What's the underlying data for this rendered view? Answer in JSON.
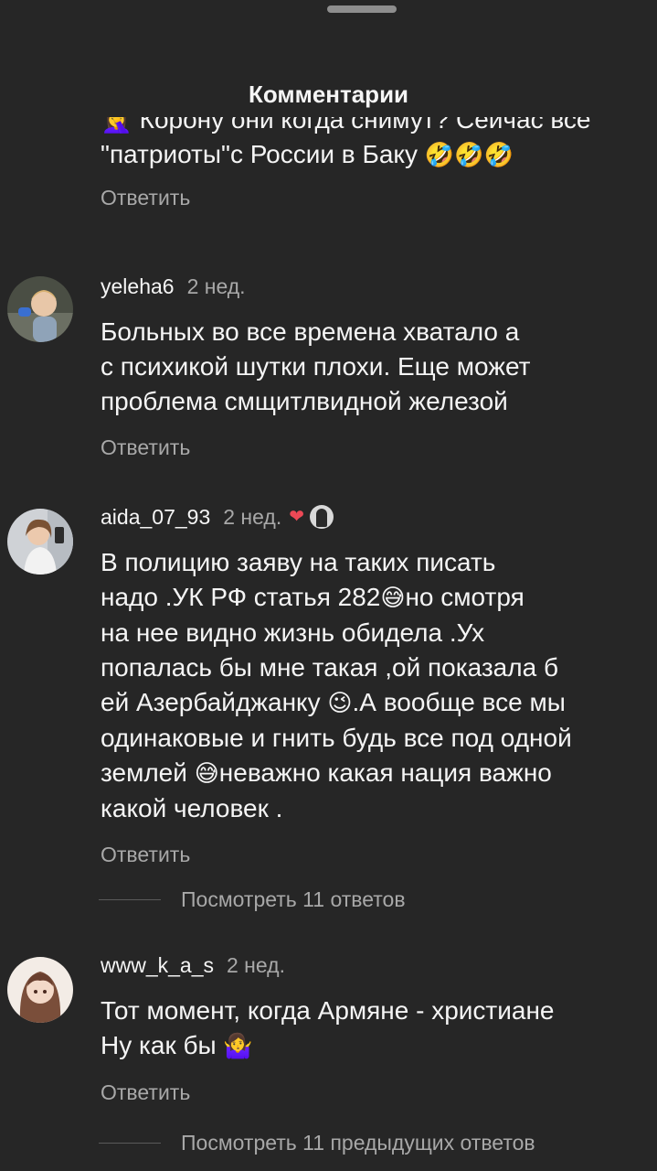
{
  "header": {
    "title": "Комментарии"
  },
  "comments": {
    "partial": {
      "clipped_line": "🤦‍♀️ Корону они когда снимут? Сейчас все",
      "text": "\"патриоты\"с России в Баку",
      "emoji": "🤣🤣🤣",
      "reply_label": "Ответить"
    },
    "items": [
      {
        "username": "yeleha6",
        "time": "2 нед.",
        "text": "Больных во все времена хватало а\nс психикой шутки плохи. Еще может\nпроблема смщитлвидной железой",
        "reply_label": "Ответить"
      },
      {
        "username": "aida_07_93",
        "time": "2 нед.",
        "heart": "❤",
        "text_part1": "В полицию заяву на таких писать\nнадо .УК РФ статья 282",
        "emoji1": "😅",
        "text_part2": "но смотря\nна нее видно жизнь обидела .Ух\nпопалась бы мне такая ,ой показала б\nей Азербайджанку ",
        "emoji2": "😉",
        "text_part3": ".А вообще все мы\nодинаковые и гнить будь все под одной\nземлей ",
        "emoji3": "😅",
        "text_part4": "неважно какая нация важно\nкакой человек .",
        "reply_label": "Ответить",
        "view_replies": "Посмотреть 11 ответов"
      },
      {
        "username": "www_k_a_s",
        "time": "2 нед.",
        "text": "Тот момент, когда Армяне - христиане\nНу как бы ",
        "emoji": "🤷‍♀️",
        "reply_label": "Ответить",
        "view_replies": "Посмотреть 11 предыдущих ответов"
      }
    ]
  }
}
